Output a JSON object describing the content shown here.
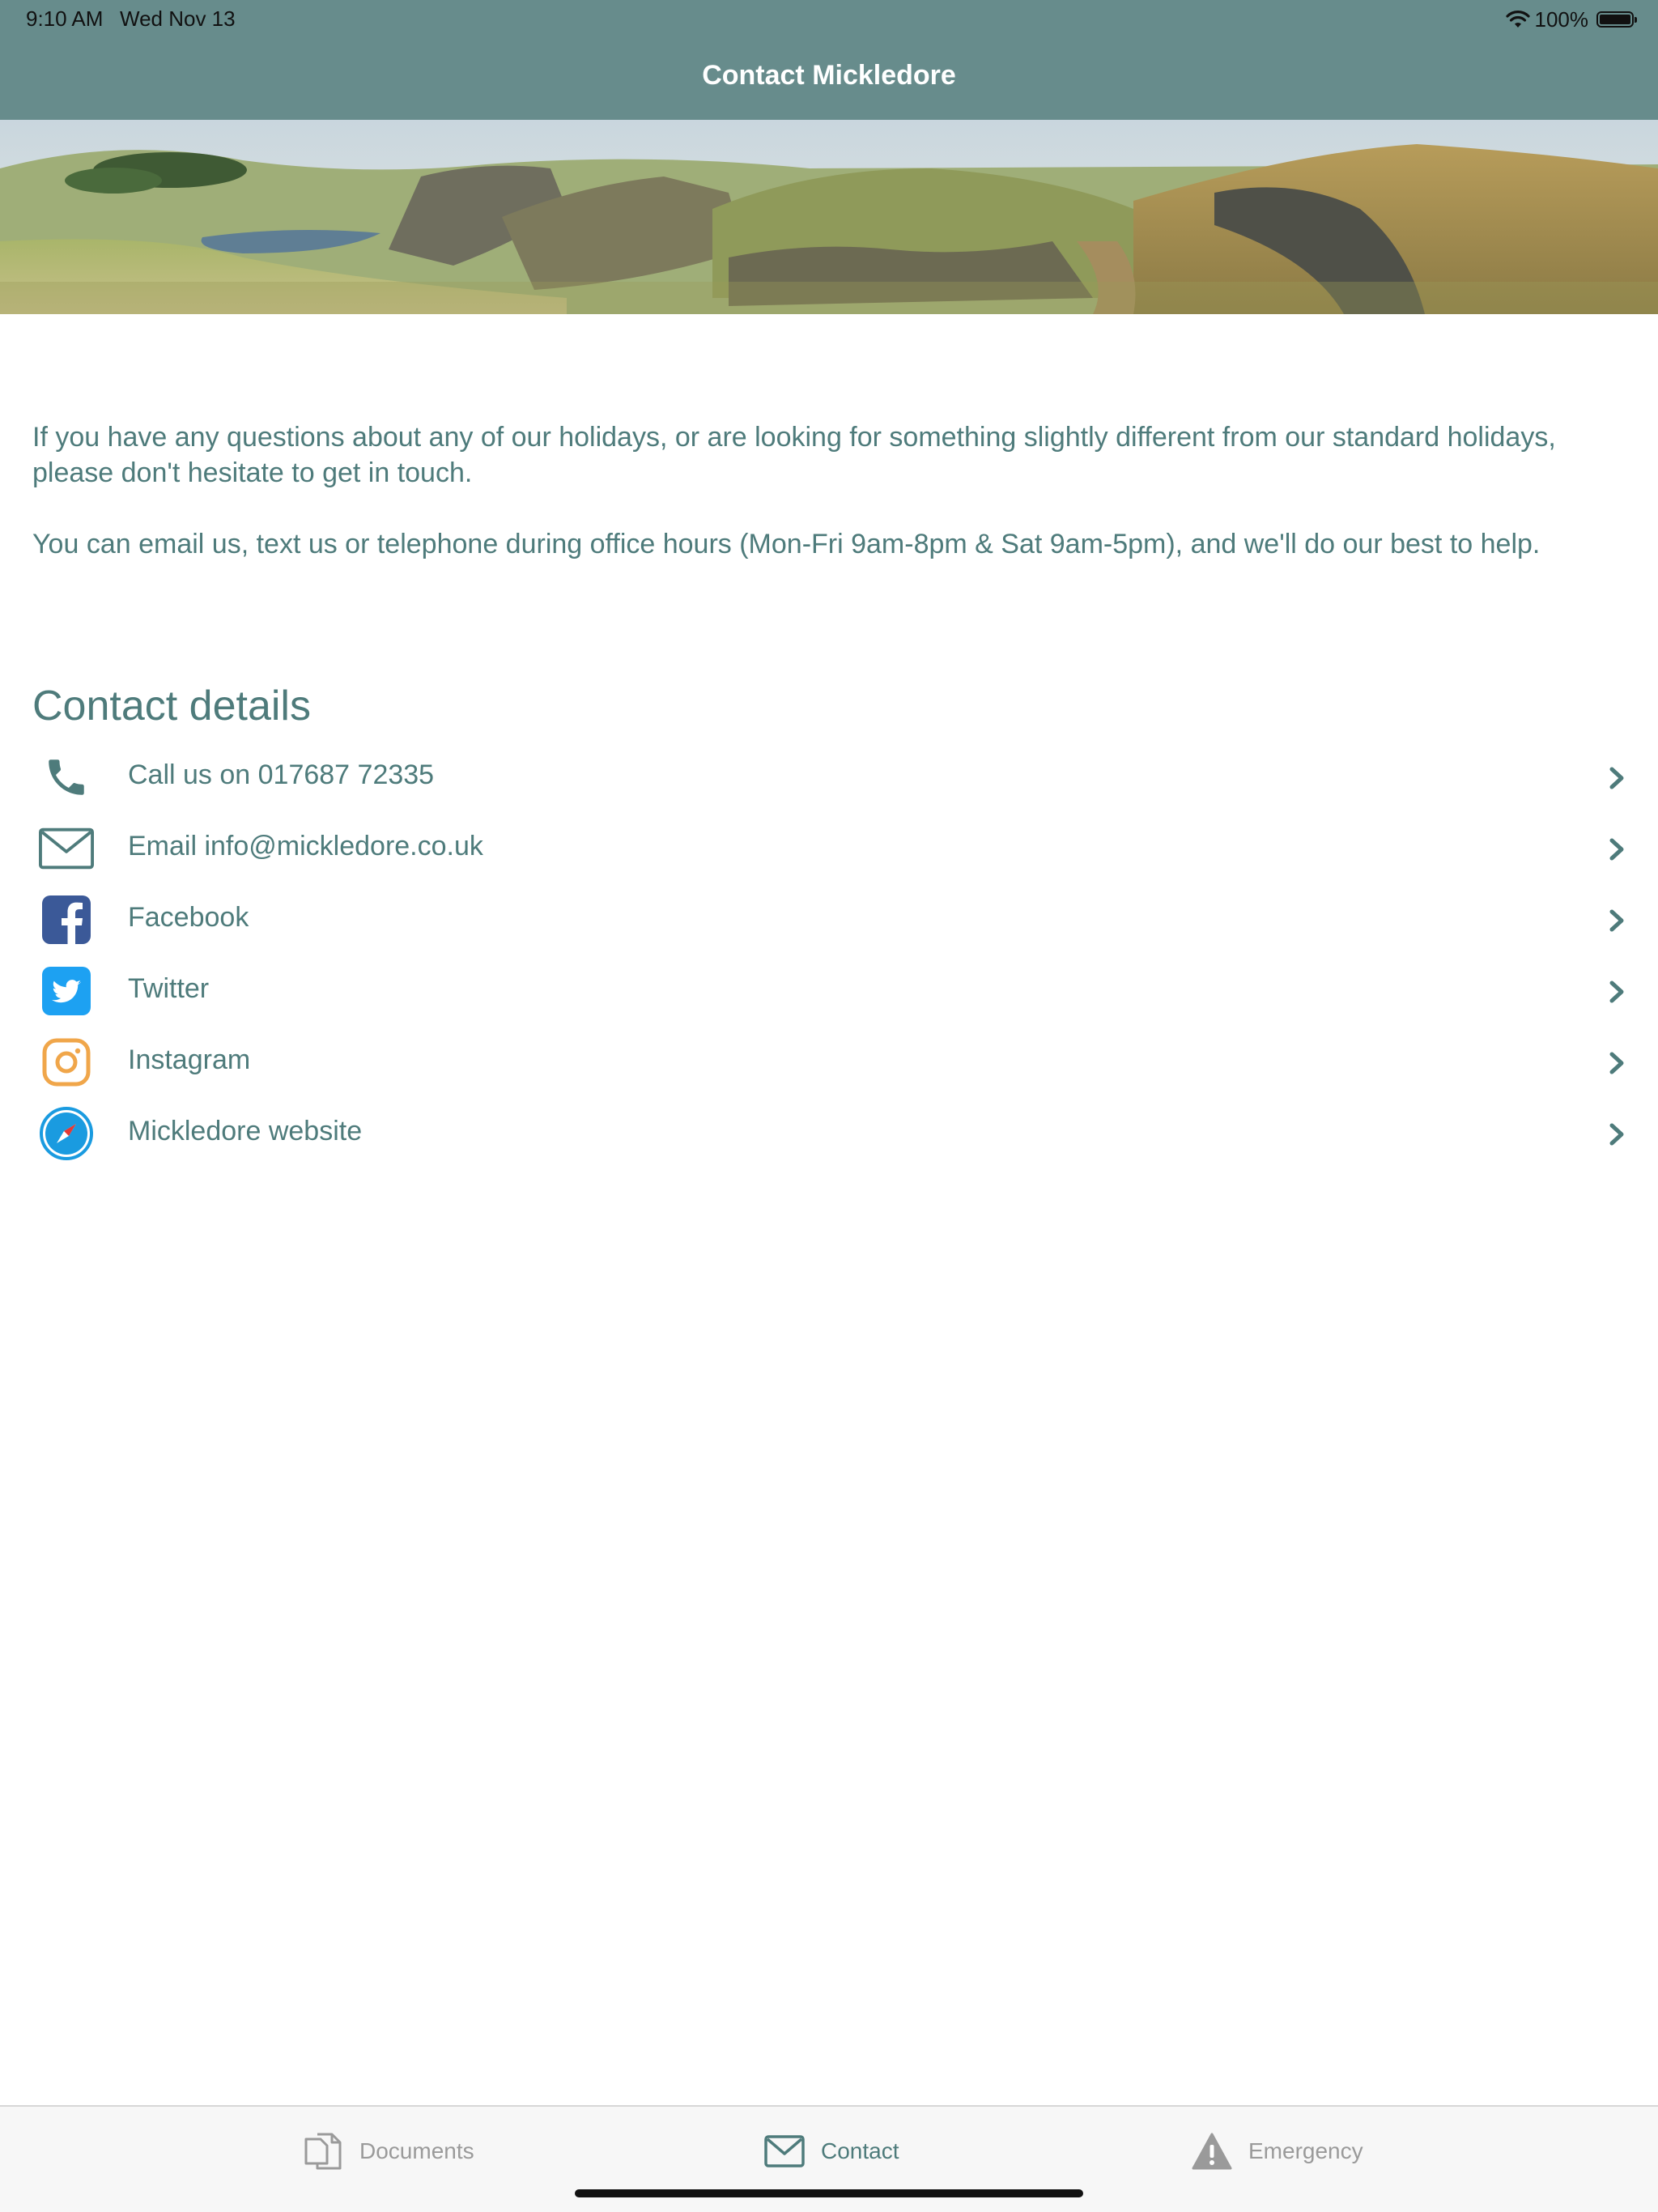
{
  "status_bar": {
    "time": "9:10 AM",
    "date": "Wed Nov 13",
    "battery": "100%"
  },
  "nav": {
    "title": "Contact Mickledore"
  },
  "intro": {
    "paragraph1": "If you have any questions about any of our holidays, or are looking for something slightly different from our standard holidays, please don't hesitate to get in touch.",
    "paragraph2": "You can email us, text us or telephone during office hours (Mon-Fri 9am-8pm & Sat 9am-5pm), and we'll do our best to help."
  },
  "contact": {
    "heading": "Contact details",
    "items": [
      {
        "label": "Call us on 017687 72335",
        "icon": "phone-icon"
      },
      {
        "label": "Email info@mickledore.co.uk",
        "icon": "envelope-icon"
      },
      {
        "label": "Facebook",
        "icon": "facebook-icon"
      },
      {
        "label": "Twitter",
        "icon": "twitter-icon"
      },
      {
        "label": "Instagram",
        "icon": "instagram-icon"
      },
      {
        "label": "Mickledore website",
        "icon": "compass-icon"
      }
    ]
  },
  "tabbar": {
    "tabs": [
      {
        "label": "Documents",
        "icon": "documents-icon",
        "selected": false
      },
      {
        "label": "Contact",
        "icon": "envelope-icon",
        "selected": true
      },
      {
        "label": "Emergency",
        "icon": "warning-icon",
        "selected": false
      }
    ]
  },
  "colors": {
    "header": "#678c8c",
    "text": "#4e7b7b",
    "facebook": "#3b5998",
    "twitter": "#1da1f2",
    "instagram": "#f0a64a",
    "safari": "#1a9be0"
  }
}
